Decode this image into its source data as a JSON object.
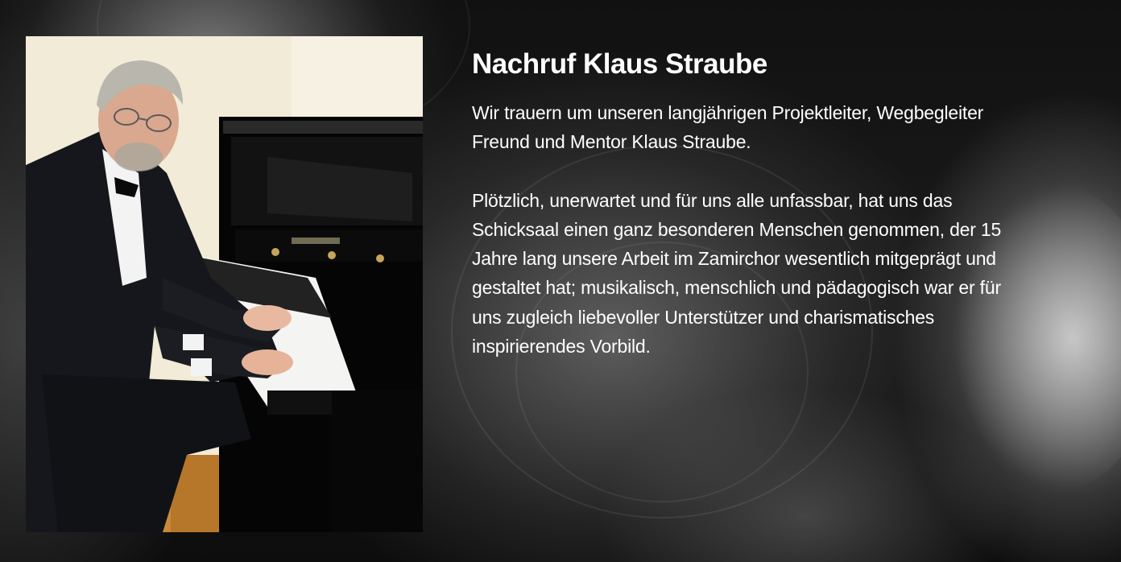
{
  "page": {
    "title": "Nachruf Klaus Straube",
    "intro_lines": [
      "Wir trauern um unseren langjährigen Projektleiter, Wegbegleiter",
      "Freund und Mentor Klaus Straube."
    ],
    "body_lines": [
      "Plötzlich, unerwartet und für uns alle unfassbar, hat uns das",
      "Schicksaal einen ganz besonderen Menschen genommen, der 15",
      "Jahre lang unsere Arbeit im Zamirchor wesentlich mitgeprägt und",
      "gestaltet hat; musikalisch, menschlich und pädagogisch war er für",
      "uns zugleich liebevoller Unterstützer und charismatisches",
      "inspirierendes Vorbild."
    ]
  },
  "colors": {
    "text": "#ffffff",
    "background": "#0a0a0a"
  }
}
